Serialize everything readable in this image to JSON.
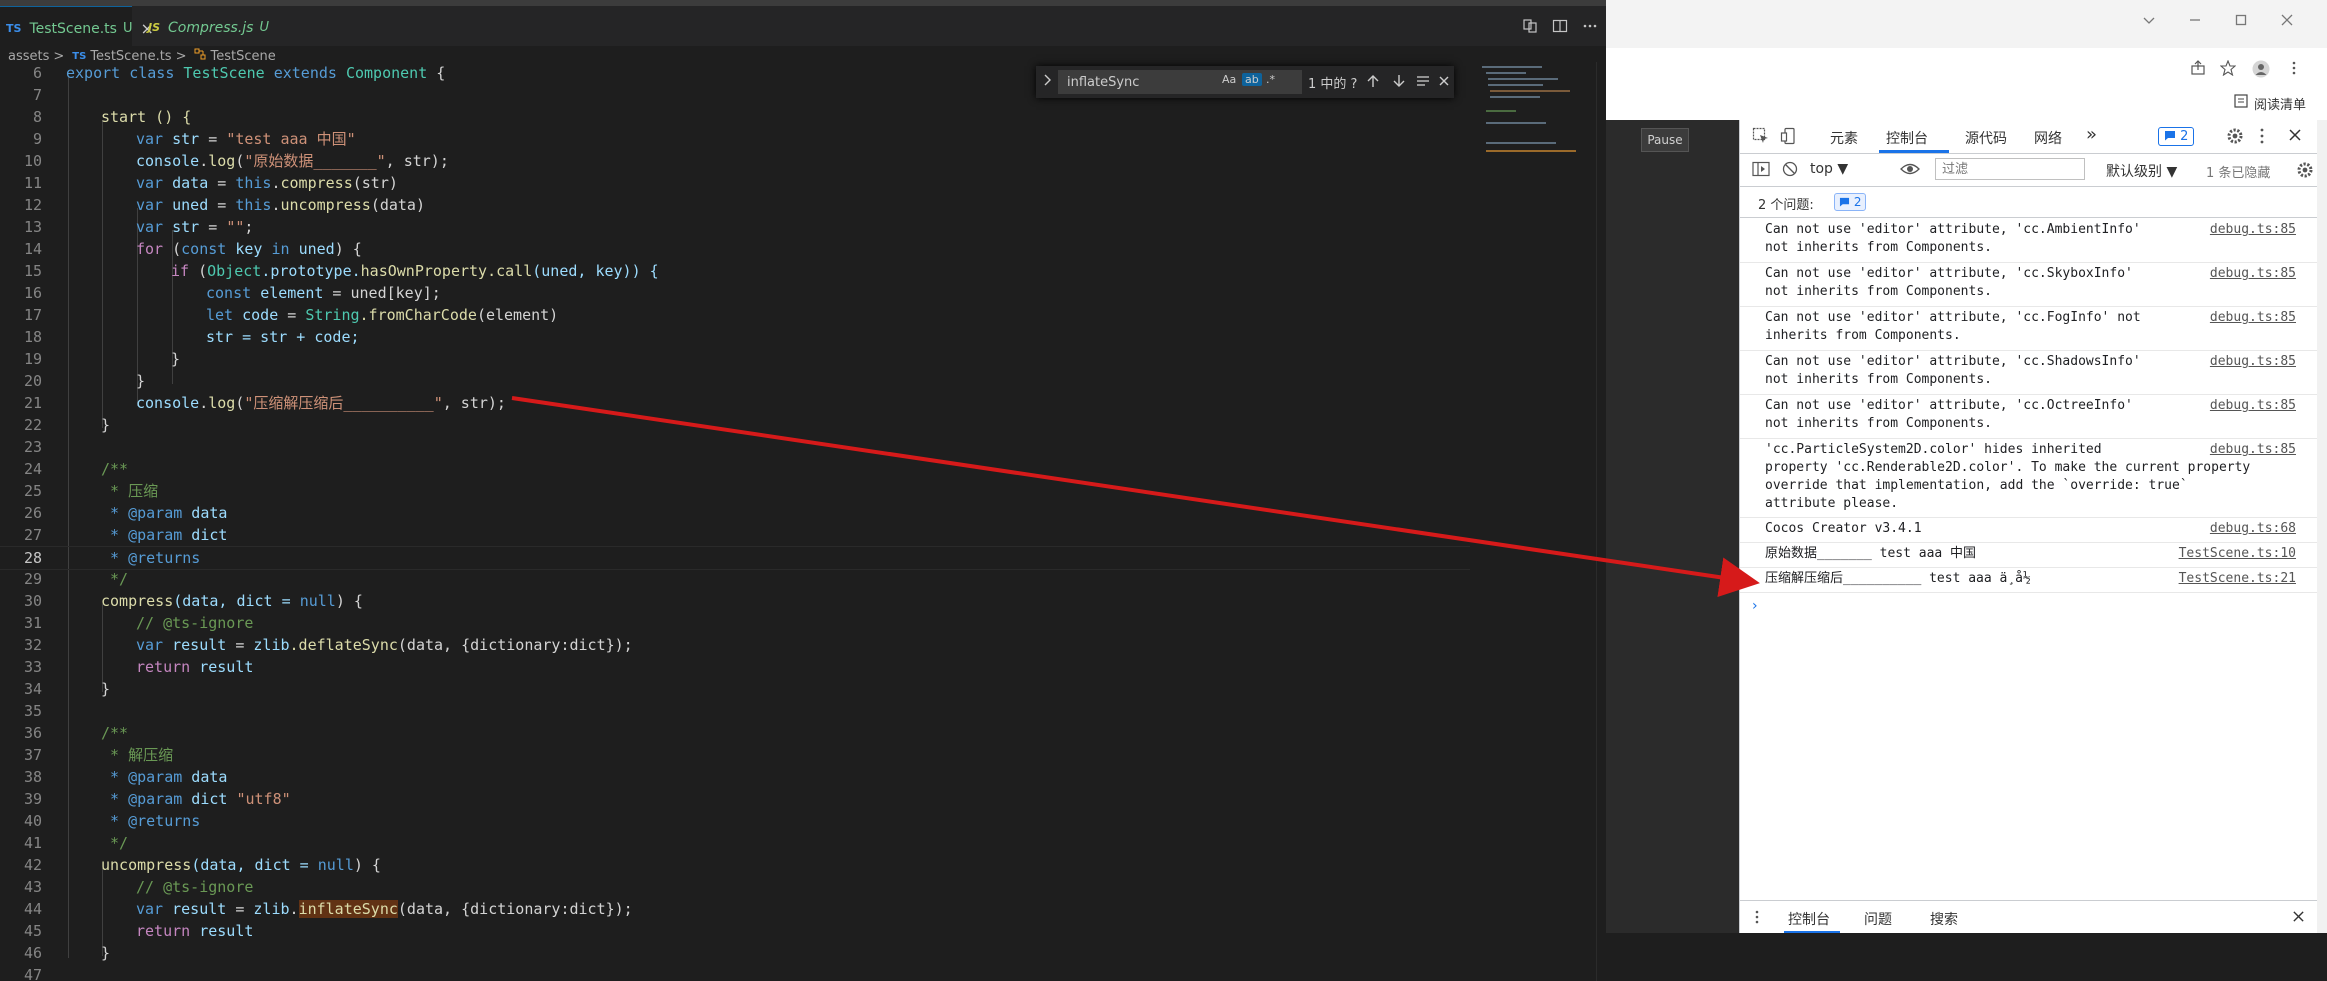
{
  "editor": {
    "tabs": [
      {
        "badge": "TS",
        "name": "TestScene.ts",
        "status": "U",
        "close": "×"
      },
      {
        "badge": "JS",
        "name": "Compress.js",
        "status": "U"
      }
    ],
    "breadcrumb": {
      "folder": "assets",
      "sep": ">",
      "file_badge": "TS",
      "file": "TestScene.ts",
      "symbol": "TestScene"
    },
    "find": {
      "query": "inflateSync",
      "opt_case": "Aa",
      "opt_word": "ab",
      "opt_regex": ".*",
      "result": "1 中的 ?"
    },
    "line_numbers": [
      "6",
      "7",
      "8",
      "9",
      "10",
      "11",
      "12",
      "13",
      "14",
      "15",
      "16",
      "17",
      "18",
      "19",
      "20",
      "21",
      "22",
      "23",
      "24",
      "25",
      "26",
      "27",
      "28",
      "29",
      "30",
      "31",
      "32",
      "33",
      "34",
      "35",
      "36",
      "37",
      "38",
      "39",
      "40",
      "41",
      "42",
      "43",
      "44",
      "45",
      "46",
      "47"
    ],
    "code": {
      "l6_export": "export",
      "l6_class": "class",
      "l6_name": "TestScene",
      "l6_extends": "extends",
      "l6_base": "Component",
      "l6_brace": "{",
      "l8": "start () {",
      "l9_var": "var",
      "l9_id": "str",
      "l9_eq": " = ",
      "l9_val": "\"test aaa 中国\"",
      "l10_obj": "console",
      "l10_fn": "log",
      "l10_open": "(",
      "l10_str": "\"原始数据_______\"",
      "l10_rest": ", str);",
      "l11_var": "var",
      "l11_id": "data",
      "l11_eq": " = ",
      "l11_this": "this",
      "l11_fn": "compress",
      "l11_rest": "(str)",
      "l12_var": "var",
      "l12_id": "uned",
      "l12_eq": " = ",
      "l12_this": "this",
      "l12_fn": "uncompress",
      "l12_rest": "(data)",
      "l13_var": "var",
      "l13_id": "str",
      "l13_eq": " = ",
      "l13_val": "\"\"",
      "l13_end": ";",
      "l14_for": "for",
      "l14_open": " (",
      "l14_const": "const",
      "l14_key": "key",
      "l14_in": "in",
      "l14_uned": "uned",
      "l14_close": ") {",
      "l15_if": "if",
      "l15_open": " (",
      "l15_obj": "Object",
      "l15_proto": ".prototype.",
      "l15_has": "hasOwnProperty",
      "l15_call": ".call",
      "l15_args": "(uned, key)) {",
      "l16_const": "const",
      "l16_id": "element",
      "l16_rest": " = uned[key];",
      "l17_let": "let",
      "l17_id": "code",
      "l17_eq": " = ",
      "l17_cls": "String",
      "l17_fn": ".fromCharCode",
      "l17_rest": "(element)",
      "l18": "str = str + code;",
      "l19": "}",
      "l20": "}",
      "l21_obj": "console",
      "l21_fn": "log",
      "l21_open": "(",
      "l21_str": "\"压缩解压缩后__________\"",
      "l21_rest": ", str);",
      "l22": "}",
      "l24": "/**",
      "l25": " * 压缩",
      "l26_at": " * @param",
      "l26_id": " data",
      "l27_at": " * @param",
      "l27_id": " dict",
      "l28": " * @returns",
      "l29": " */",
      "l30_fn": "compress",
      "l30_args": "(data, dict = ",
      "l30_null": "null",
      "l30_end": ") {",
      "l31": "// @ts-ignore",
      "l32_var": "var",
      "l32_id": "result",
      "l32_eq": " = ",
      "l32_obj": "zlib",
      "l32_fn": ".deflateSync",
      "l32_rest": "(data, {dictionary:dict});",
      "l33_ret": "return",
      "l33_id": " result",
      "l34": "}",
      "l36": "/**",
      "l37": " * 解压缩",
      "l38_at": " * @param",
      "l38_id": " data",
      "l39_at": " * @param",
      "l39_id": " dict",
      "l39_str": " \"utf8\"",
      "l40": " * @returns",
      "l41": " */",
      "l42_fn": "uncompress",
      "l42_args": "(data, dict = ",
      "l42_null": "null",
      "l42_end": ") {",
      "l43": "// @ts-ignore",
      "l44_var": "var",
      "l44_id": "result",
      "l44_eq": " = ",
      "l44_obj": "zlib",
      "l44_dot": ".",
      "l44_fn": "inflateSync",
      "l44_rest": "(data, {dictionary:dict});",
      "l45_ret": "return",
      "l45_id": " result",
      "l46": "}"
    }
  },
  "browser": {
    "reading_list": "阅读清单",
    "pause": "Pause",
    "devtools": {
      "tabs": [
        "元素",
        "控制台",
        "源代码",
        "网络"
      ],
      "more": "»",
      "issues_badge": "2",
      "context": "top ▼",
      "filter_placeholder": "过滤",
      "levels": "默认级别 ▼",
      "hidden": "1 条已隐藏",
      "issues_label": "2 个问题:",
      "issues_count": "2",
      "messages": [
        {
          "text": "Can not use 'editor' attribute, 'cc.AmbientInfo'\nnot inherits from Components.",
          "src": "debug.ts:85"
        },
        {
          "text": "Can not use 'editor' attribute, 'cc.SkyboxInfo'\nnot inherits from Components.",
          "src": "debug.ts:85"
        },
        {
          "text": "Can not use 'editor' attribute, 'cc.FogInfo' not\ninherits from Components.",
          "src": "debug.ts:85"
        },
        {
          "text": "Can not use 'editor' attribute, 'cc.ShadowsInfo'\nnot inherits from Components.",
          "src": "debug.ts:85"
        },
        {
          "text": "Can not use 'editor' attribute, 'cc.OctreeInfo'\nnot inherits from Components.",
          "src": "debug.ts:85"
        },
        {
          "text": "'cc.ParticleSystem2D.color' hides inherited\nproperty 'cc.Renderable2D.color'. To make the current property\noverride that implementation, add the `override: true`\nattribute please.",
          "src": "debug.ts:85"
        },
        {
          "text": "Cocos Creator v3.4.1",
          "src": "debug.ts:68"
        },
        {
          "text": "原始数据_______ test aaa 中国",
          "src": "TestScene.ts:10"
        },
        {
          "text": "压缩解压缩后__________ test aaa ä¸å½",
          "src": "TestScene.ts:21"
        }
      ],
      "prompt": "›",
      "drawer": [
        "控制台",
        "问题",
        "搜索"
      ]
    }
  },
  "colors": {
    "annotation_arrow": "#d61a1a",
    "accent": "#1a73e8"
  }
}
